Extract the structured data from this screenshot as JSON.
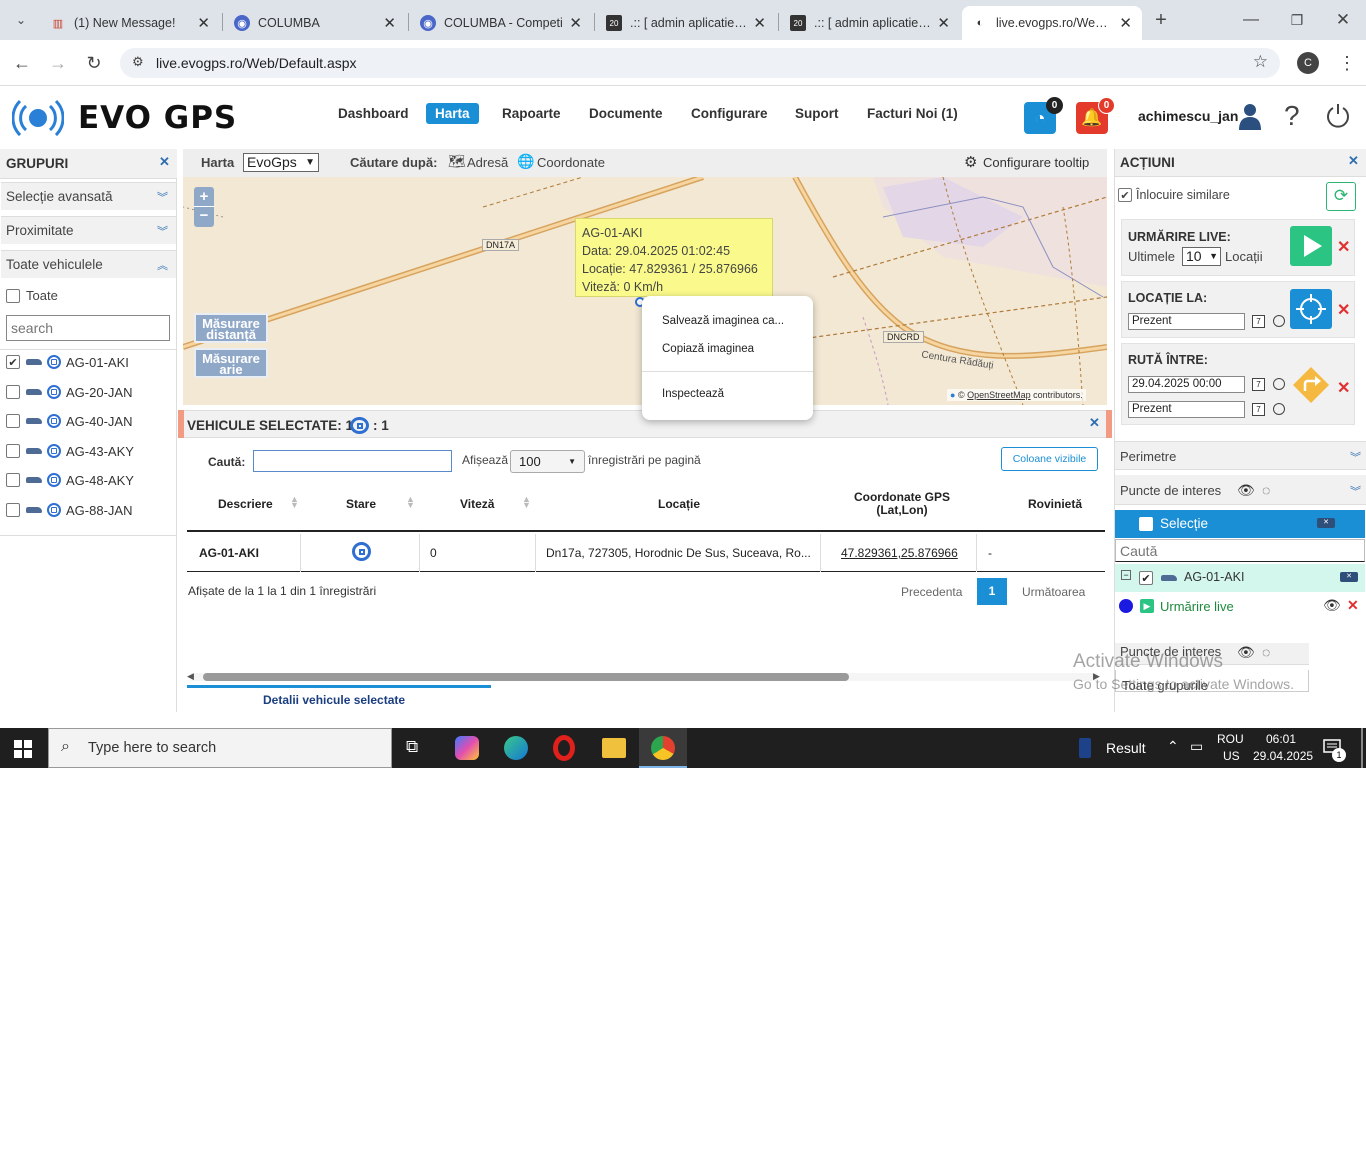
{
  "browser": {
    "tabs": [
      {
        "title": "(1) New Message!",
        "icon": "popcorn-icon"
      },
      {
        "title": "COLUMBA",
        "icon": "firefox-icon"
      },
      {
        "title": "COLUMBA - Competi",
        "icon": "firefox-icon"
      },
      {
        "title": ".:: [ admin aplicatie pe",
        "icon": "app-icon"
      },
      {
        "title": ".:: [ admin aplicatie pe",
        "icon": "app-icon"
      },
      {
        "title": "live.evogps.ro/Web/D",
        "icon": "page-icon"
      }
    ],
    "url": "live.evogps.ro/Web/Default.aspx",
    "profile_initial": "C"
  },
  "app": {
    "logo_text": "EVO GPS",
    "menu": [
      "Dashboard",
      "Harta",
      "Rapoarte",
      "Documente",
      "Configurare",
      "Suport",
      "Facturi Noi (1)"
    ],
    "active_menu": "Harta",
    "rss_count": "0",
    "alert_count": "0",
    "username": "achimescu_jan"
  },
  "left_panel": {
    "title": "GRUPURI",
    "sections": [
      "Selecție avansată",
      "Proximitate",
      "Toate vehiculele"
    ],
    "all_label": "Toate",
    "search_placeholder": "search",
    "vehicles": [
      {
        "name": "AG-01-AKI",
        "checked": true
      },
      {
        "name": "AG-20-JAN",
        "checked": false
      },
      {
        "name": "AG-40-JAN",
        "checked": false
      },
      {
        "name": "AG-43-AKY",
        "checked": false
      },
      {
        "name": "AG-48-AKY",
        "checked": false
      },
      {
        "name": "AG-88-JAN",
        "checked": false
      }
    ]
  },
  "map_toolbar": {
    "harta_label": "Harta",
    "map_select": "EvoGps",
    "search_by": "Căutare după:",
    "address": "Adresă",
    "coords": "Coordonate",
    "tooltip_config": "Configurare tooltip"
  },
  "map": {
    "zoom_in": "+",
    "zoom_out": "−",
    "measure_distance": "Măsurare distanță",
    "measure_area": "Măsurare arie",
    "road_labels": [
      "DN17A",
      "DNCRD",
      "Centura Rădăuți"
    ],
    "attribution_prefix": "©",
    "attribution_link": "OpenStreetMap",
    "attribution_suffix": "contributors.",
    "tooltip": {
      "plate": "AG-01-AKI",
      "date": "Data: 29.04.2025 01:02:45",
      "location": "Locație: 47.829361 / 25.876966",
      "speed": "Viteză: 0 Km/h"
    },
    "context_menu": [
      "Salvează imaginea ca...",
      "Copiază imaginea",
      "Inspectează"
    ]
  },
  "selected_panel": {
    "title": "VEHICULE SELECTATE: 1",
    "stop_count": ": 1",
    "search_label": "Caută:",
    "show_label": "Afișează",
    "page_size": "100",
    "per_page_label": "înregistrări pe pagină",
    "columns_button": "Coloane vizibile",
    "headers": [
      "Descriere",
      "Stare",
      "Viteză",
      "Locație",
      "Coordonate GPS (Lat,Lon)",
      "Rovinietă"
    ],
    "rows": [
      {
        "descriere": "AG-01-AKI",
        "viteza": "0",
        "locatie": "Dn17a, 727305, Horodnic De Sus, Suceava, Ro...",
        "coords": "47.829361,25.876966",
        "rovinieta": "-"
      }
    ],
    "info": "Afișate de la 1 la 1 din 1 înregistrări",
    "prev": "Precedenta",
    "page": "1",
    "next": "Următoarea",
    "footer_tab": "Detalii vehicule selectate"
  },
  "right_panel": {
    "title": "ACȚIUNI",
    "replace_similar": "Înlocuire similare",
    "live_label": "URMĂRIRE LIVE:",
    "last_label": "Ultimele",
    "last_count": "10",
    "locations_label": "Locații",
    "location_at": "LOCAȚIE LA:",
    "location_value": "Prezent",
    "route_between": "RUTĂ ÎNTRE:",
    "route_from": "29.04.2025 00:00",
    "route_to": "Prezent",
    "calendar_day": "7",
    "perimeters": "Perimetre",
    "poi": "Puncte de interes",
    "selection": "Selecție",
    "search_placeholder": "Caută",
    "selected_vehicle": "AG-01-AKI",
    "live_tracking": "Urmărire live",
    "poi_bottom": "Puncte de interes",
    "all_groups": "Toate grupurile"
  },
  "watermark": {
    "line1": "Activate Windows",
    "line2": "Go to Settings to activate Windows."
  },
  "taskbar": {
    "search_placeholder": "Type here to search",
    "result_label": "Result",
    "lang1": "ROU",
    "lang2": "US",
    "time": "06:01",
    "date": "29.04.2025",
    "notif_count": "1"
  },
  "colors": {
    "accent": "#1a8fd6",
    "tooltip": "#fafa8c",
    "map_bg": "#f2e8d4",
    "taskbar": "#1f1f1f"
  }
}
